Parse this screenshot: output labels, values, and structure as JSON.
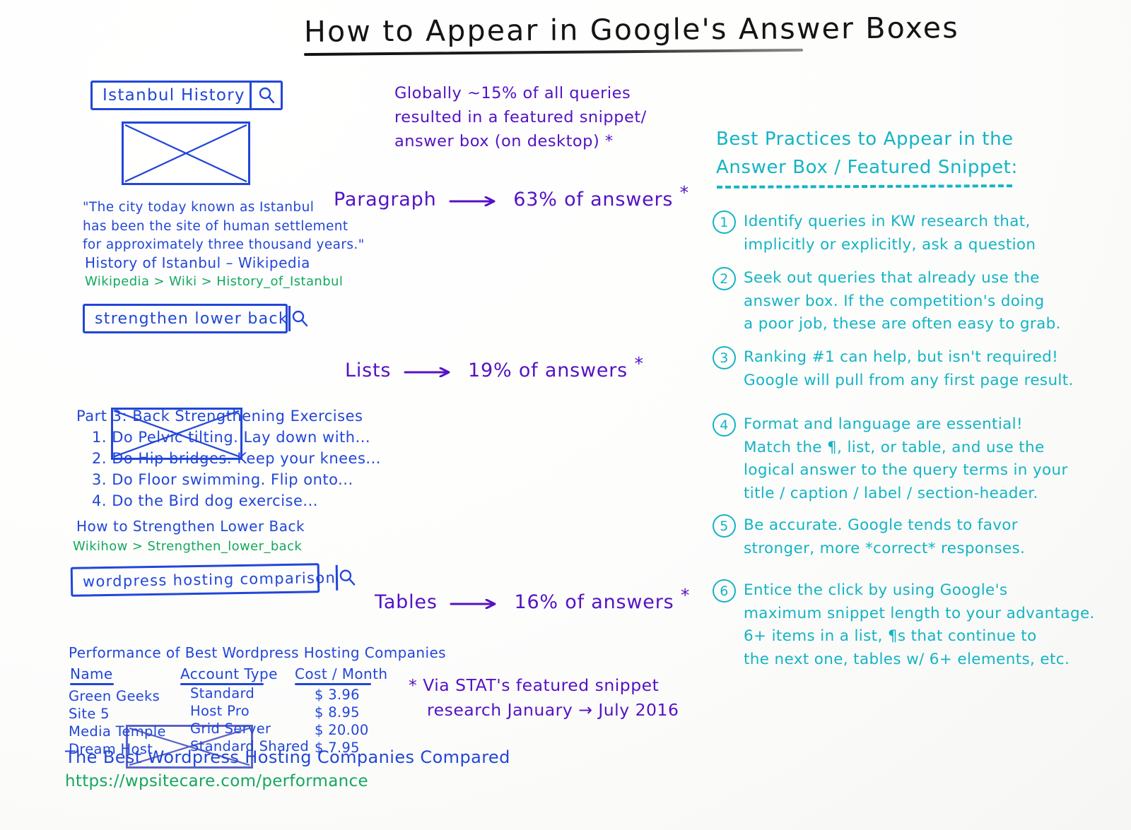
{
  "title": "How to Appear in Google's Answer Boxes",
  "serp_examples": [
    {
      "query": "Istanbul History",
      "icon": "magnifier-icon",
      "snippet_lines": [
        "\"The city today known as Istanbul",
        "has been the site of human settlement",
        "for approximately three thousand years.\""
      ],
      "result_title": "History of Istanbul – Wikipedia",
      "result_url": "Wikipedia > Wiki > History_of_Istanbul"
    },
    {
      "query": "strengthen lower back",
      "icon": "magnifier-icon",
      "list_heading": "Part 3: Back Strengthening Exercises",
      "list_items": [
        "1. Do Pelvic tilting. Lay down with...",
        "2. Do Hip bridges.  Keep your knees...",
        "3. Do Floor swimming. Flip onto...",
        "4. Do the Bird dog exercise..."
      ],
      "result_title": "How to Strengthen Lower Back",
      "result_url": "Wikihow > Strengthen_lower_back"
    },
    {
      "query": "wordpress hosting comparison",
      "icon": "magnifier-icon",
      "table_caption": "Performance of Best Wordpress Hosting Companies",
      "table": {
        "columns": [
          "Name",
          "Account Type",
          "Cost / Month"
        ],
        "rows": [
          [
            "Green Geeks",
            "Standard",
            "$ 3.96"
          ],
          [
            "Site 5",
            "Host Pro",
            "$ 8.95"
          ],
          [
            "Media Temple",
            "Grid Server",
            "$ 20.00"
          ],
          [
            "Dream Host",
            "Standard Shared",
            "$ 7.95"
          ]
        ]
      },
      "result_title": "The Best Wordpress Hosting Companies Compared",
      "result_url": "https://wpsitecare.com/performance"
    }
  ],
  "stats": {
    "intro_lines": [
      "Globally ~15% of all queries",
      "resulted in a featured snippet/",
      "answer box (on desktop) *"
    ],
    "breakdown": [
      {
        "label": "Paragraph",
        "value": "63% of answers",
        "footnote_marker": "*"
      },
      {
        "label": "Lists",
        "value": "19% of answers",
        "footnote_marker": "*"
      },
      {
        "label": "Tables",
        "value": "16% of answers",
        "footnote_marker": "*"
      }
    ],
    "footnote_lines": [
      "* Via STAT's featured snippet",
      "research January → July 2016"
    ]
  },
  "best_practices": {
    "heading_lines": [
      "Best Practices to Appear in the",
      "Answer Box / Featured Snippet:"
    ],
    "items": [
      {
        "number": "1",
        "lines": [
          "Identify queries in KW research that,",
          "implicitly or explicitly, ask a question"
        ]
      },
      {
        "number": "2",
        "lines": [
          "Seek out queries that already use the",
          "answer box. If the competition's doing",
          "a poor job, these are often easy to grab."
        ]
      },
      {
        "number": "3",
        "lines": [
          "Ranking #1 can help, but isn't required!",
          "Google will pull from any first page result."
        ]
      },
      {
        "number": "4",
        "lines": [
          "Format and language are essential!",
          "Match the ¶, list, or table, and use the",
          "logical answer to the query terms in your",
          "title / caption / label / section-header."
        ]
      },
      {
        "number": "5",
        "lines": [
          "Be accurate. Google tends to favor",
          "stronger, more *correct* responses."
        ]
      },
      {
        "number": "6",
        "lines": [
          "Entice the click by using Google's",
          "maximum snippet length to your advantage.",
          "6+ items in a list, ¶s that continue to",
          "the next one, tables w/ 6+ elements, etc."
        ]
      }
    ]
  },
  "colors": {
    "blue": "#2246d8",
    "green": "#15a85e",
    "purple": "#5412c4",
    "teal": "#14b4c4",
    "ink": "#141414"
  }
}
